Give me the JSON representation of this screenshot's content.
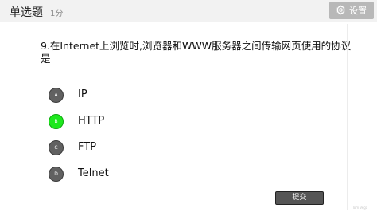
{
  "header": {
    "question_type": "单选题",
    "score": "1分",
    "settings_label": "设置",
    "settings_icon": "gear-icon"
  },
  "question": {
    "text": "9.在Internet上浏览时,浏览器和WWW服务器之间传输网页使用的协议是"
  },
  "options": [
    {
      "letter": "A",
      "text": "IP",
      "selected": false
    },
    {
      "letter": "B",
      "text": "HTTP",
      "selected": true
    },
    {
      "letter": "C",
      "text": "FTP",
      "selected": false
    },
    {
      "letter": "D",
      "text": "Telnet",
      "selected": false
    }
  ],
  "submit_label": "提交",
  "watermark": "Tom Vega",
  "colors": {
    "selected": "#1ee81e",
    "unselected": "#616161",
    "header_bg": "#f2f2f2",
    "button_bg": "#555555"
  }
}
